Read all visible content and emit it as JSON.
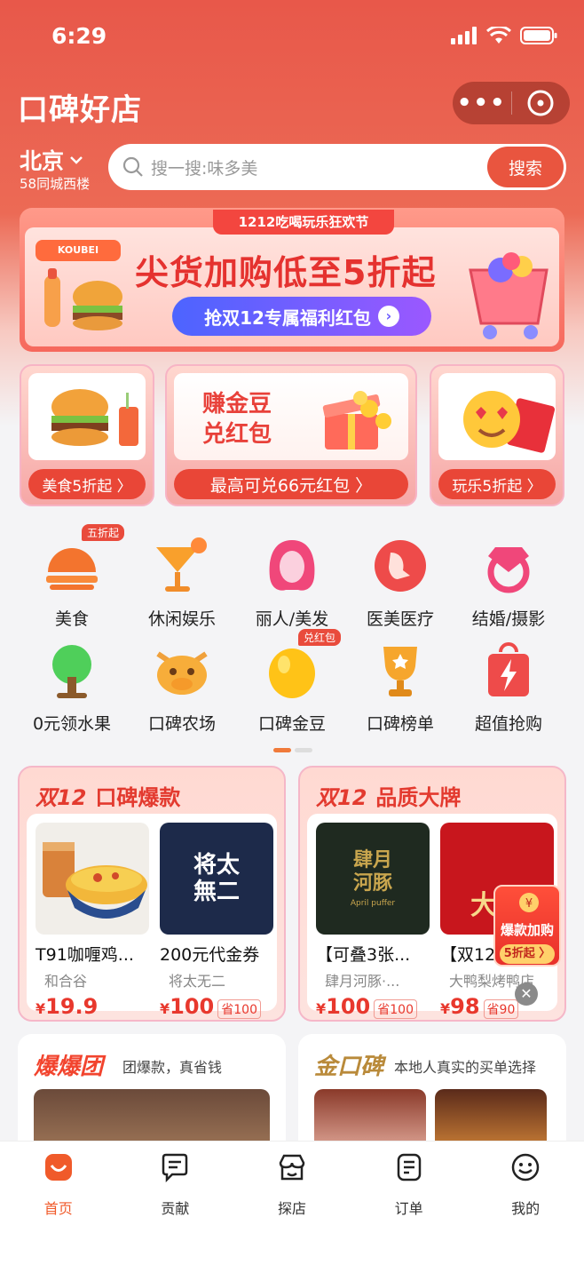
{
  "status_bar": {
    "time": "6:29"
  },
  "header": {
    "title": "口碑好店",
    "more_label": "•••"
  },
  "location": {
    "city": "北京",
    "district": "58同城西楼"
  },
  "search": {
    "placeholder": "搜一搜:味多美",
    "button": "搜索"
  },
  "banner": {
    "tag": "1212吃喝玩乐狂欢节",
    "logo": "KOUBEI",
    "headline": "尖货加购低至5折起",
    "cta": "抢双12专属福利红包"
  },
  "promos": [
    {
      "label": "美食5折起 〉"
    },
    {
      "title_line1": "赚金豆",
      "title_line2": "兑红包",
      "label": "最高可兑66元红包 〉"
    },
    {
      "label": "玩乐5折起 〉"
    }
  ],
  "categories": [
    {
      "name": "美食",
      "badge": "五折起",
      "icon": "hamburger-icon"
    },
    {
      "name": "休闲娱乐",
      "icon": "cocktail-icon"
    },
    {
      "name": "丽人/美发",
      "icon": "hair-salon-icon"
    },
    {
      "name": "医美医疗",
      "icon": "medical-beauty-icon"
    },
    {
      "name": "结婚/摄影",
      "icon": "diamond-ring-icon"
    },
    {
      "name": "0元领水果",
      "icon": "fruit-tree-icon"
    },
    {
      "name": "口碑农场",
      "icon": "cow-icon"
    },
    {
      "name": "口碑金豆",
      "badge": "兑红包",
      "icon": "gold-bean-icon"
    },
    {
      "name": "口碑榜单",
      "icon": "trophy-icon"
    },
    {
      "name": "超值抢购",
      "icon": "flash-bag-icon"
    }
  ],
  "cards": [
    {
      "prefix": "双12",
      "title": "口碑爆款",
      "items": [
        {
          "title": "T91咖喱鸡...",
          "store": "和合谷",
          "currency": "¥",
          "price": "19.9",
          "save": ""
        },
        {
          "title": "200元代金券",
          "store": "将太无二",
          "currency": "¥",
          "price": "100",
          "save": "省100",
          "image_text": "将太無二"
        }
      ]
    },
    {
      "prefix": "双12",
      "title": "品质大牌",
      "items": [
        {
          "title": "【可叠3张...",
          "store": "肆月河豚·...",
          "currency": "¥",
          "price": "100",
          "save": "省100",
          "image_text": "肆月河豚",
          "image_sub": "April puffer"
        },
        {
          "title": "【双12...",
          "store": "大鸭梨烤鸭店",
          "currency": "¥",
          "price": "98",
          "save": "省90",
          "image_text": "大鸭"
        }
      ]
    }
  ],
  "lower_cards": [
    {
      "logo": "爆爆团",
      "subtitle": "团爆款，真省钱"
    },
    {
      "logo": "金口碑",
      "subtitle": "本地人真实的买单选择"
    }
  ],
  "floating": {
    "title": "爆款加购",
    "tag": "5折起 〉",
    "close": "✕"
  },
  "tabbar": [
    {
      "label": "首页",
      "icon": "home-face-icon",
      "active": true
    },
    {
      "label": "贡献",
      "icon": "contribute-icon"
    },
    {
      "label": "探店",
      "icon": "shop-icon"
    },
    {
      "label": "订单",
      "icon": "order-icon"
    },
    {
      "label": "我的",
      "icon": "profile-icon"
    }
  ],
  "colors": {
    "brand": "#e9553f",
    "accent": "#f05a2a",
    "price": "#e8382d"
  }
}
